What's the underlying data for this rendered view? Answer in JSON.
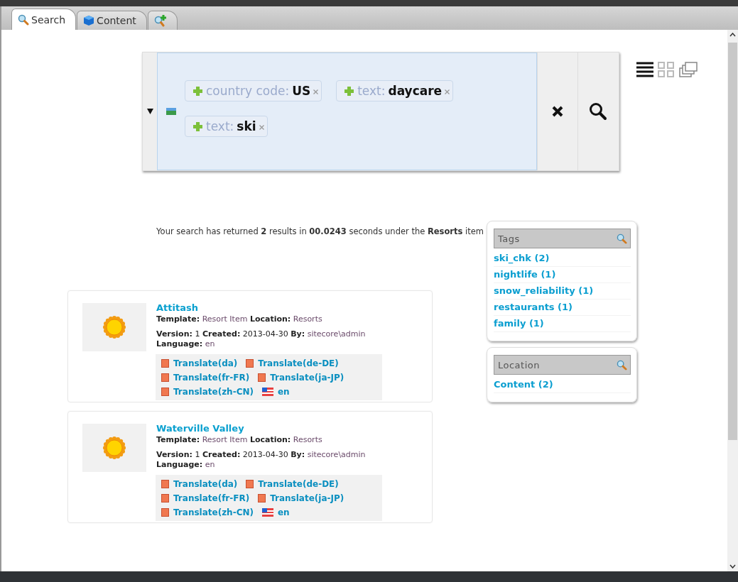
{
  "tabs": [
    {
      "label": "Search",
      "kind": "search",
      "selected": true
    },
    {
      "label": "Content",
      "kind": "cube",
      "selected": false
    },
    {
      "kind": "add-search",
      "selected": false
    }
  ],
  "search": {
    "chips": [
      {
        "name": "country code:",
        "value": "US"
      },
      {
        "name": "text:",
        "value": "daycare"
      },
      {
        "name": "text:",
        "value": "ski"
      }
    ]
  },
  "summary": "Your search has returned **2** results in **00.0243** seconds under the **Resorts** item",
  "results": [
    {
      "title": "Attitash",
      "labels": {
        "template": "Template:",
        "location": "Location:",
        "version": "Version:",
        "created": "Created:",
        "by": "By:",
        "language": "Language:"
      },
      "template": "Resort Item",
      "location": "Resorts",
      "version": "1",
      "created": "2013-04-30",
      "by": "sitecore\\admin",
      "language": "en",
      "links": [
        {
          "label": "Translate(da)",
          "kind": "translate"
        },
        {
          "label": "Translate(de-DE)",
          "kind": "translate"
        },
        {
          "label": "Translate(fr-FR)",
          "kind": "translate"
        },
        {
          "label": "Translate(ja-JP)",
          "kind": "translate"
        },
        {
          "label": "Translate(zh-CN)",
          "kind": "translate"
        },
        {
          "label": "en",
          "kind": "flag"
        }
      ]
    },
    {
      "title": "Waterville Valley",
      "labels": {
        "template": "Template:",
        "location": "Location:",
        "version": "Version:",
        "created": "Created:",
        "by": "By:",
        "language": "Language:"
      },
      "template": "Resort Item",
      "location": "Resorts",
      "version": "1",
      "created": "2013-04-30",
      "by": "sitecore\\admin",
      "language": "en",
      "links": [
        {
          "label": "Translate(da)",
          "kind": "translate"
        },
        {
          "label": "Translate(de-DE)",
          "kind": "translate"
        },
        {
          "label": "Translate(fr-FR)",
          "kind": "translate"
        },
        {
          "label": "Translate(ja-JP)",
          "kind": "translate"
        },
        {
          "label": "Translate(zh-CN)",
          "kind": "translate"
        },
        {
          "label": "en",
          "kind": "flag"
        }
      ]
    }
  ],
  "facets": [
    {
      "title": "Tags",
      "items": [
        "ski_chk (2)",
        "nightlife (1)",
        "snow_reliability (1)",
        "restaurants (1)",
        "family (1)"
      ]
    },
    {
      "title": "Location",
      "items": [
        "Content (2)"
      ]
    }
  ]
}
